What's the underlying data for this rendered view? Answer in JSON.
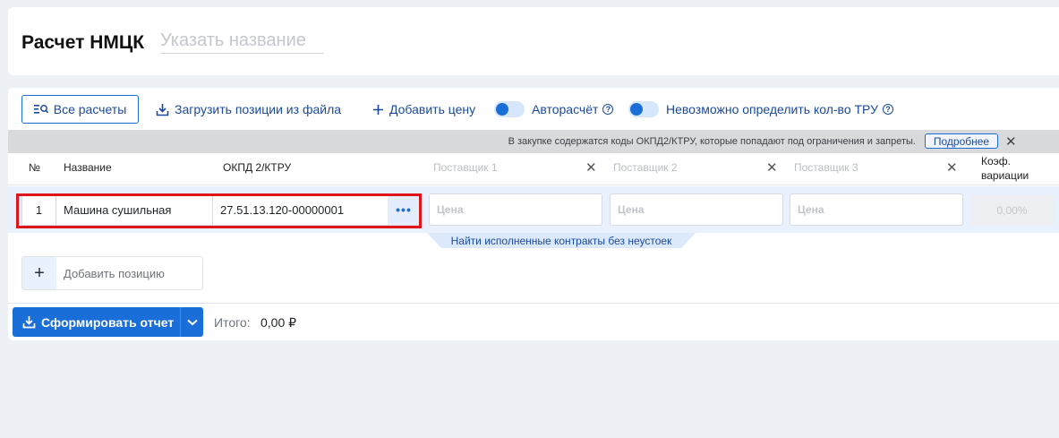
{
  "header": {
    "title": "Расчет НМЦК",
    "name_placeholder": "Указать название"
  },
  "toolbar": {
    "all_calcs_label": "Все расчеты",
    "upload_label": "Загрузить позиции из файла",
    "add_price_label": "Добавить цену",
    "autocalc_label": "Авторасчёт",
    "cannot_determine_label": "Невозможно определить кол-во ТРУ"
  },
  "warning": {
    "text": "В закупке содержатся коды ОКПД2/КТРУ, которые попадают под ограничения и запреты.",
    "more_label": "Подробнее"
  },
  "table": {
    "headers": {
      "num": "№",
      "name": "Название",
      "okpd": "ОКПД 2/КТРУ",
      "supplier1": "Поставщик 1",
      "supplier2": "Поставщик 2",
      "supplier3": "Поставщик 3",
      "coef_line1": "Коэф.",
      "coef_line2": "вариации"
    },
    "rows": [
      {
        "num": "1",
        "name": "Машина сушильная",
        "okpd": "27.51.13.120-00000001",
        "price_placeholder": "Цена",
        "coef": "0,00%"
      }
    ],
    "contracts_link": "Найти исполненные контракты без неустоек",
    "add_position_label": "Добавить позицию"
  },
  "footer": {
    "report_label": "Сформировать отчет",
    "total_label": "Итого:",
    "total_value": "0,00 ₽"
  },
  "colors": {
    "accent": "#1a6ed8",
    "highlight": "#e0141b",
    "warning_bg": "#d9dadb"
  }
}
